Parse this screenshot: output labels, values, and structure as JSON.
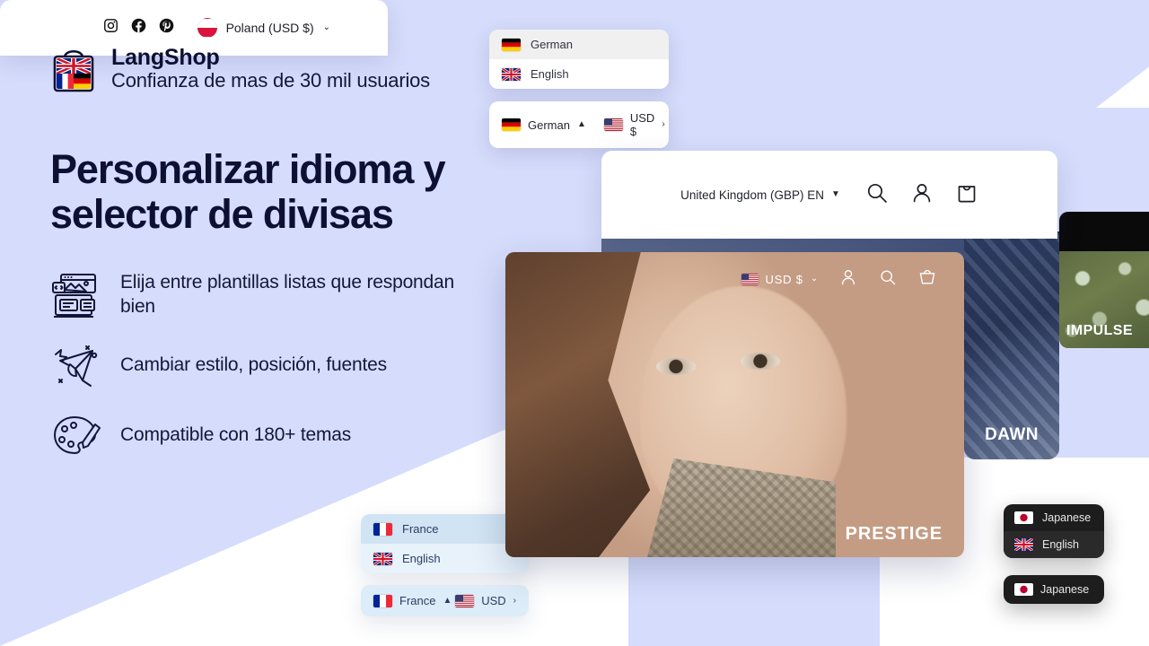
{
  "theme": {
    "background": "#d6dcfb",
    "text_dark": "#0d1033",
    "panel_white": "#ffffff",
    "panel_blue": "#dcecf8",
    "panel_dark": "#1d1d1d"
  },
  "brand": {
    "name": "LangShop",
    "tagline": "Confianza de mas de 30 mil usuarios",
    "logo_icon": "shopping-bag-flags-icon"
  },
  "headline": "Personalizar idioma y selector de divisas",
  "features": [
    {
      "icon": "layout-template-icon",
      "text": "Elija entre plantillas listas que respondan bien"
    },
    {
      "icon": "magic-wand-cursor-icon",
      "text": "Cambiar estilo, posición, fuentes"
    },
    {
      "icon": "paint-palette-icon",
      "text": "Compatible con 180+ temas"
    }
  ],
  "german_widget": {
    "options": [
      {
        "flag": "de",
        "label": "German",
        "selected": true
      },
      {
        "flag": "gb",
        "label": "English",
        "selected": false
      }
    ],
    "bar": {
      "language_flag": "de",
      "language_label": "German",
      "language_caret": "▲",
      "currency_flag": "us",
      "currency_label": "USD $",
      "currency_caret": "›"
    }
  },
  "poland_card": {
    "social_icons": [
      "instagram-icon",
      "facebook-icon",
      "pinterest-icon"
    ],
    "selector": {
      "flag": "pl",
      "label": "Poland (USD $)",
      "caret": "⌄"
    }
  },
  "uk_card": {
    "selector_label": "United Kingdom (GBP) EN",
    "selector_caret": "▼",
    "icons": [
      "search-icon",
      "account-icon",
      "cart-icon"
    ]
  },
  "model_card": {
    "currency_flag": "us",
    "currency_label": "USD $",
    "currency_caret": "⌄",
    "icons": [
      "account-icon",
      "search-icon",
      "cart-icon"
    ],
    "theme_label": "PRESTIGE"
  },
  "dawn_card": {
    "theme_label": "DAWN"
  },
  "impulse_card": {
    "theme_label": "IMPULSE"
  },
  "france_widget": {
    "options": [
      {
        "flag": "fr",
        "label": "France",
        "selected": true
      },
      {
        "flag": "gb",
        "label": "English",
        "selected": false
      }
    ],
    "bar": {
      "language_flag": "fr",
      "language_label": "France",
      "language_caret": "▲",
      "currency_flag": "us",
      "currency_label": "USD",
      "currency_caret": "›"
    }
  },
  "japanese_widget": {
    "options": [
      {
        "flag": "jp",
        "label": "Japanese",
        "selected": true
      },
      {
        "flag": "gb",
        "label": "English",
        "selected": false
      }
    ],
    "bar": {
      "language_flag": "jp",
      "language_label": "Japanese",
      "language_caret": "▲"
    }
  }
}
